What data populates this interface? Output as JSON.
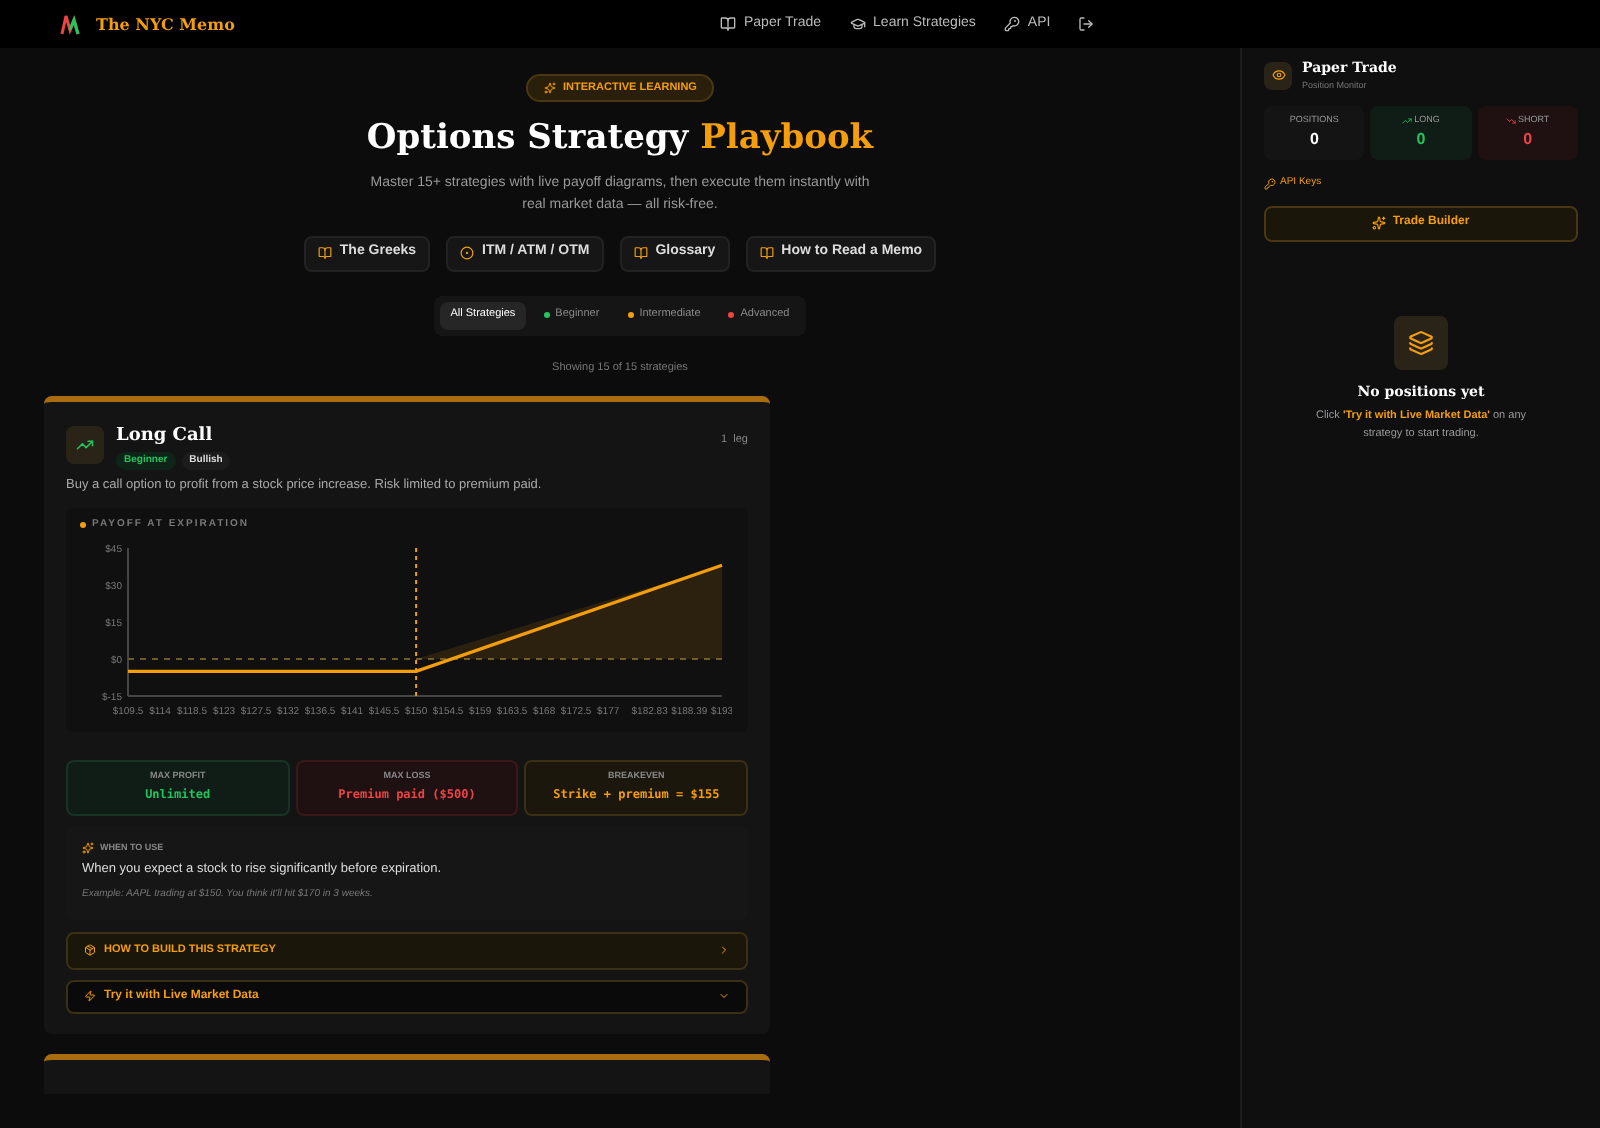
{
  "brand": "The NYC Memo",
  "nav": [
    {
      "label": "Paper Trade",
      "kind": "book"
    },
    {
      "label": "Learn Strategies",
      "kind": "cap"
    },
    {
      "label": "API",
      "kind": "key"
    }
  ],
  "hero": {
    "badge": "INTERACTIVE LEARNING",
    "title": "Options Strategy ",
    "title_accent": "Playbook",
    "subtitle": "Master 15+ strategies with live payoff diagrams, then execute them instantly with real market data — all risk-free."
  },
  "guides": [
    {
      "label": "The Greeks",
      "kind": "book"
    },
    {
      "label": "ITM / ATM / OTM",
      "kind": "circle"
    },
    {
      "label": "Glossary",
      "kind": "book"
    },
    {
      "label": "How to Read a Memo",
      "kind": "book"
    }
  ],
  "filters": [
    {
      "label": "All Strategies",
      "selected": true
    },
    {
      "label": "Beginner",
      "selected": false,
      "color": "#22c55e"
    },
    {
      "label": "Intermediate",
      "selected": false,
      "color": "#f59e0b"
    },
    {
      "label": "Advanced",
      "selected": false,
      "color": "#ef4444"
    }
  ],
  "showing": "Showing 15 of 15 strategies",
  "strategy": {
    "name": "Long Call",
    "tags": [
      {
        "label": "Beginner",
        "kind": "level"
      },
      {
        "label": "Bullish",
        "kind": "bias"
      }
    ],
    "legs": "1 leg",
    "description": "Buy a call option to profit from a stock price increase. Risk limited to premium paid.",
    "chart_title": "PAYOFF AT EXPIRATION",
    "chart_data": {
      "type": "line",
      "x": [
        109.5,
        150,
        193
      ],
      "series": [
        {
          "color": "#f59e0b",
          "values": [
            -5,
            -5,
            38
          ]
        }
      ],
      "xlim": [
        109.5,
        193
      ],
      "ylim": [
        -15,
        45
      ],
      "yticks": [
        {
          "value": 45,
          "label": "$45"
        },
        {
          "value": 30,
          "label": "$30"
        },
        {
          "value": 15,
          "label": "$15"
        },
        {
          "value": 0,
          "label": "$0"
        },
        {
          "value": -15,
          "label": "$-15"
        }
      ],
      "xticks": [
        {
          "value": 109.5,
          "label": "$109.5"
        },
        {
          "value": 114,
          "label": "$114"
        },
        {
          "value": 118.5,
          "label": "$118.5"
        },
        {
          "value": 123,
          "label": "$123"
        },
        {
          "value": 127.5,
          "label": "$127.5"
        },
        {
          "value": 132,
          "label": "$132"
        },
        {
          "value": 136.5,
          "label": "$136.5"
        },
        {
          "value": 141,
          "label": "$141"
        },
        {
          "value": 145.5,
          "label": "$145.5"
        },
        {
          "value": 150,
          "label": "$150"
        },
        {
          "value": 154.5,
          "label": "$154.5"
        },
        {
          "value": 159,
          "label": "$159"
        },
        {
          "value": 163.5,
          "label": "$163.5"
        },
        {
          "value": 168,
          "label": "$168"
        },
        {
          "value": 172.5,
          "label": "$172.5"
        },
        {
          "value": 177,
          "label": "$177"
        },
        {
          "value": 182.83,
          "label": "$182.83"
        },
        {
          "value": 188.39,
          "label": "$188.39"
        },
        {
          "value": 193,
          "label": "$193"
        }
      ],
      "ref_lines": [
        {
          "axis": "y",
          "value": 0
        },
        {
          "axis": "x",
          "value": 150
        }
      ]
    },
    "stats": [
      {
        "label": "MAX PROFIT",
        "value": "Unlimited",
        "kind": "profit"
      },
      {
        "label": "MAX LOSS",
        "value": "Premium paid ($500)",
        "kind": "loss"
      },
      {
        "label": "BREAKEVEN",
        "value": "Strike + premium = $155",
        "kind": "even"
      }
    ],
    "when_label": "WHEN TO USE",
    "when_text": "When you expect a stock to rise significantly before expiration.",
    "example": "Example: AAPL trading at $150. You think it'll hit $170 in 3 weeks.",
    "build": {
      "label": "HOW TO BUILD THIS STRATEGY",
      "expanded": false
    },
    "live": {
      "label": "Try it with Live Market Data",
      "expanded": false
    }
  },
  "panel": {
    "title": "Paper Trade",
    "subtitle": "Position Monitor",
    "counters": [
      {
        "label": "POSITIONS",
        "value": "0",
        "kind": "total"
      },
      {
        "label": "LONG",
        "value": "0",
        "kind": "long"
      },
      {
        "label": "SHORT",
        "value": "0",
        "kind": "short"
      }
    ],
    "api_keys": "API Keys",
    "trade_builder": "Trade Builder",
    "empty_title": "No positions yet",
    "empty_pre": "Click ",
    "empty_link": "'Try it with Live Market Data'",
    "empty_post": " on any strategy to start trading."
  }
}
